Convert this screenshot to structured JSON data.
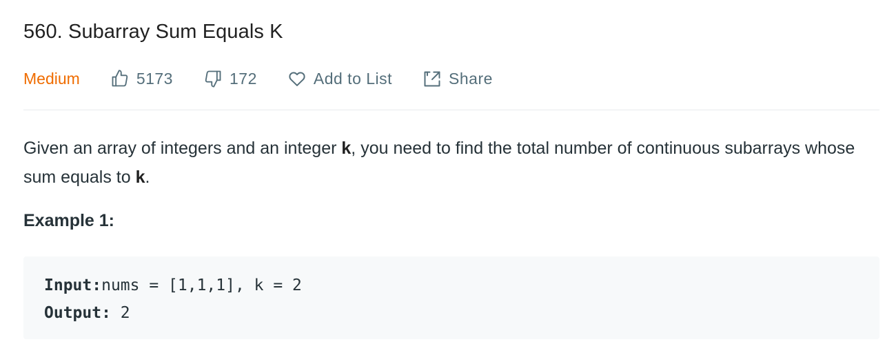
{
  "problem": {
    "title": "560. Subarray Sum Equals K",
    "difficulty": "Medium",
    "likes": "5173",
    "dislikes": "172",
    "add_to_list_label": "Add to List",
    "share_label": "Share"
  },
  "description": {
    "part1": "Given an array of integers and an integer ",
    "k1": "k",
    "part2": ", you need to find the total number of continuous subarrays whose sum equals to ",
    "k2": "k",
    "part3": "."
  },
  "example": {
    "heading": "Example 1:",
    "input_label": "Input:",
    "input_value": "nums = [1,1,1], k = 2",
    "output_label": "Output:",
    "output_value": " 2"
  },
  "colors": {
    "difficulty": "#ef6c00",
    "meta": "#546e7a",
    "example_bg": "#f7f9fa"
  },
  "icons": [
    "thumbs-up-icon",
    "thumbs-down-icon",
    "heart-icon",
    "share-icon"
  ]
}
